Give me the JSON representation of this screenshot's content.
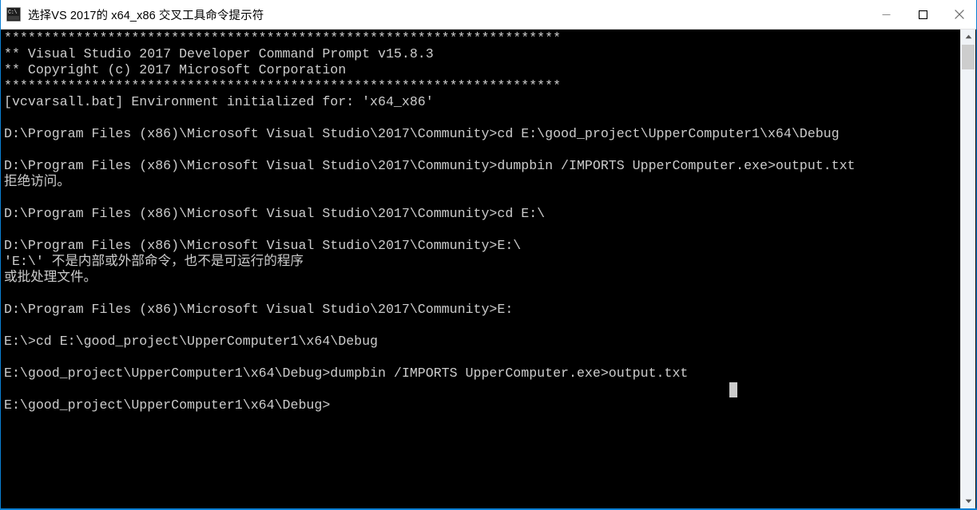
{
  "window": {
    "title": "选择VS 2017的 x64_x86 交叉工具命令提示符",
    "icon": "cmd-console-icon",
    "accent_color": "#0a7fd4",
    "titlebar_background": "#ffffff",
    "titlebar_text_color": "#000000"
  },
  "window_controls": {
    "minimize": "minimize-icon",
    "maximize": "maximize-icon",
    "close": "close-icon"
  },
  "console": {
    "background_color": "#000000",
    "foreground_color": "#cccccc",
    "cursor": "block-cursor",
    "banner_separator": "**********************************************************************",
    "lines": [
      "**********************************************************************",
      "** Visual Studio 2017 Developer Command Prompt v15.8.3",
      "** Copyright (c) 2017 Microsoft Corporation",
      "**********************************************************************",
      "[vcvarsall.bat] Environment initialized for: 'x64_x86'",
      "",
      "D:\\Program Files (x86)\\Microsoft Visual Studio\\2017\\Community>cd E:\\good_project\\UpperComputer1\\x64\\Debug",
      "",
      "D:\\Program Files (x86)\\Microsoft Visual Studio\\2017\\Community>dumpbin /IMPORTS UpperComputer.exe>output.txt",
      "拒绝访问。",
      "",
      "D:\\Program Files (x86)\\Microsoft Visual Studio\\2017\\Community>cd E:\\",
      "",
      "D:\\Program Files (x86)\\Microsoft Visual Studio\\2017\\Community>E:\\",
      "'E:\\' 不是内部或外部命令，也不是可运行的程序",
      "或批处理文件。",
      "",
      "D:\\Program Files (x86)\\Microsoft Visual Studio\\2017\\Community>E:",
      "",
      "E:\\>cd E:\\good_project\\UpperComputer1\\x64\\Debug",
      "",
      "E:\\good_project\\UpperComputer1\\x64\\Debug>dumpbin /IMPORTS UpperComputer.exe>output.txt",
      "",
      "E:\\good_project\\UpperComputer1\\x64\\Debug>"
    ],
    "text": "**********************************************************************\n** Visual Studio 2017 Developer Command Prompt v15.8.3\n** Copyright (c) 2017 Microsoft Corporation\n**********************************************************************\n[vcvarsall.bat] Environment initialized for: 'x64_x86'\n\nD:\\Program Files (x86)\\Microsoft Visual Studio\\2017\\Community>cd E:\\good_project\\UpperComputer1\\x64\\Debug\n\nD:\\Program Files (x86)\\Microsoft Visual Studio\\2017\\Community>dumpbin /IMPORTS UpperComputer.exe>output.txt\n拒绝访问。\n\nD:\\Program Files (x86)\\Microsoft Visual Studio\\2017\\Community>cd E:\\\n\nD:\\Program Files (x86)\\Microsoft Visual Studio\\2017\\Community>E:\\\n'E:\\' 不是内部或外部命令，也不是可运行的程序\n或批处理文件。\n\nD:\\Program Files (x86)\\Microsoft Visual Studio\\2017\\Community>E:\n\nE:\\>cd E:\\good_project\\UpperComputer1\\x64\\Debug\n\nE:\\good_project\\UpperComputer1\\x64\\Debug>dumpbin /IMPORTS UpperComputer.exe>output.txt\n\nE:\\good_project\\UpperComputer1\\x64\\Debug>"
  },
  "scrollbar": {
    "up_arrow": "chevron-up-icon",
    "down_arrow": "chevron-down-icon",
    "thumb_color": "#cdcdcd",
    "track_color": "#f0f3f7"
  }
}
